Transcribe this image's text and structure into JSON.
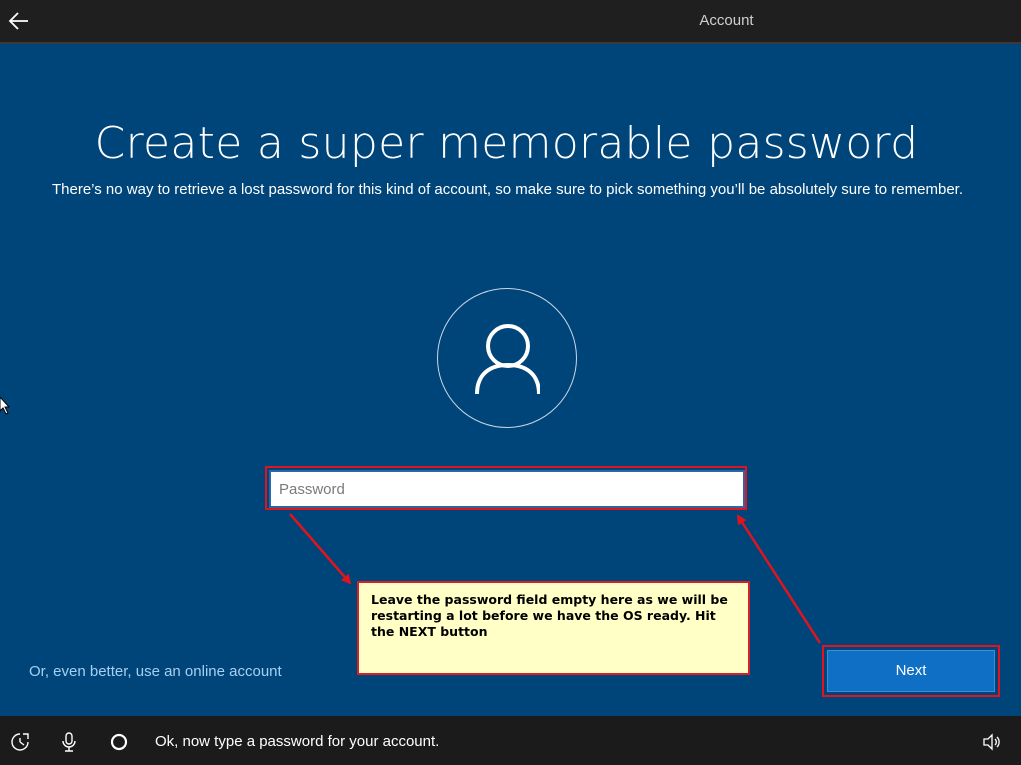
{
  "header": {
    "tab_label": "Account",
    "back_icon": "arrow-left-icon"
  },
  "main": {
    "title": "Create a super memorable password",
    "subtitle": "There’s no way to retrieve a lost password for this kind of account, so make sure to pick something you’ll be absolutely sure to remember.",
    "avatar_icon": "user-icon",
    "password": {
      "value": "",
      "placeholder": "Password"
    },
    "annotation": "Leave the password field empty here as we will be restarting a lot before we have the OS ready. Hit the NEXT button",
    "online_account_link": "Or, even better, use an online account",
    "next_label": "Next"
  },
  "footer": {
    "prompt": "Ok, now type a password for your account.",
    "icons": [
      "ease-of-access-icon",
      "microphone-icon",
      "cortana-icon",
      "volume-icon"
    ]
  },
  "colors": {
    "background": "#00457a",
    "bars": "#1b1b1b",
    "accent": "#0f6fc4",
    "highlight": "#e0141e",
    "note_bg": "#ffffc6",
    "link": "#a5d0f2"
  }
}
